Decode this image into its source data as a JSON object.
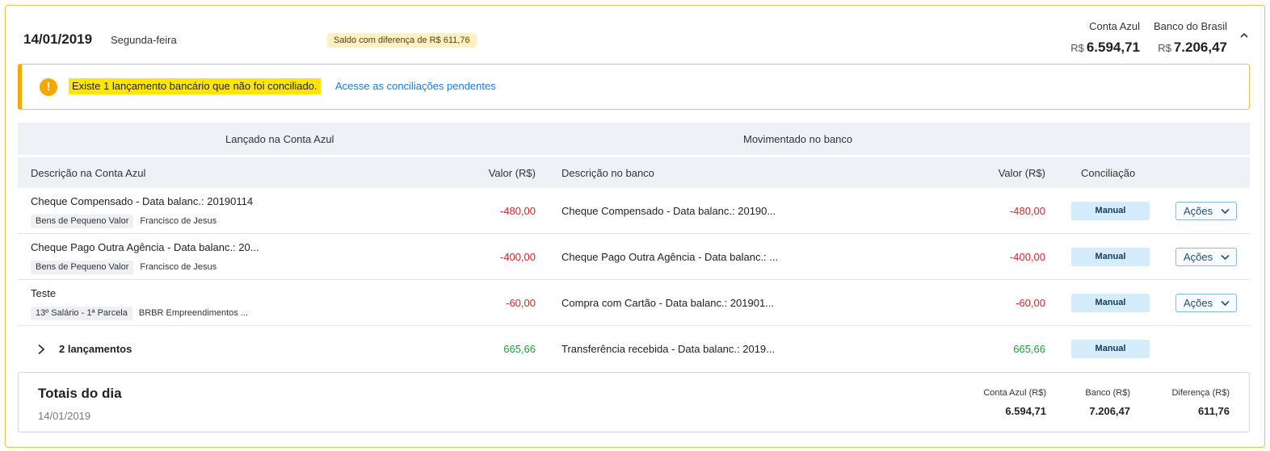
{
  "header": {
    "date": "14/01/2019",
    "weekday": "Segunda-feira",
    "badge": "Saldo com diferença de R$ 611,76",
    "accounts": [
      {
        "name": "Conta Azul",
        "currency": "R$",
        "value": "6.594,71"
      },
      {
        "name": "Banco do Brasil",
        "currency": "R$",
        "value": "7.206,47"
      }
    ],
    "collapse_icon": "chevron-up-icon"
  },
  "alert": {
    "icon": "exclamation-icon",
    "message": "Existe 1 lançamento bancário que não foi conciliado.",
    "link": "Acesse as conciliações pendentes",
    "accent_color": "#f2ac00"
  },
  "table": {
    "group_headers": [
      "Lançado na Conta Azul",
      "Movimentado no banco"
    ],
    "columns": [
      "Descrição na Conta Azul",
      "Valor (R$)",
      "Descrição no banco",
      "Valor (R$)",
      "Conciliação"
    ],
    "rows": [
      {
        "desc": "Cheque Compensado - Data balanc.: 20190114",
        "tags": [
          "Bens de Pequeno Valor",
          "Francisco de Jesus"
        ],
        "value": "-480,00",
        "bank_desc": "Cheque Compensado - Data balanc.: 20190...",
        "bank_value": "-480,00",
        "conciliation": "Manual",
        "actions": "Ações"
      },
      {
        "desc": "Cheque Pago Outra Agência - Data balanc.: 20...",
        "tags": [
          "Bens de Pequeno Valor",
          "Francisco de Jesus"
        ],
        "value": "-400,00",
        "bank_desc": "Cheque Pago Outra Agência - Data balanc.: ...",
        "bank_value": "-400,00",
        "conciliation": "Manual",
        "actions": "Ações"
      },
      {
        "desc": "Teste",
        "tags": [
          "13º Salário - 1ª Parcela",
          "BRBR Empreendimentos ..."
        ],
        "value": "-60,00",
        "bank_desc": "Compra com Cartão - Data balanc.: 201901...",
        "bank_value": "-60,00",
        "conciliation": "Manual",
        "actions": "Ações"
      }
    ],
    "group_row": {
      "label": "2 lançamentos",
      "value": "665,66",
      "bank_desc": "Transferência recebida - Data balanc.: 2019...",
      "bank_value": "665,66",
      "conciliation": "Manual"
    }
  },
  "totals": {
    "title": "Totais do dia",
    "date": "14/01/2019",
    "columns": [
      {
        "label": "Conta Azul (R$)",
        "value": "6.594,71"
      },
      {
        "label": "Banco (R$)",
        "value": "7.206,47"
      },
      {
        "label": "Diferença (R$)",
        "value": "611,76"
      }
    ]
  },
  "colors": {
    "negative": "#d9232d",
    "positive": "#1e9e3e",
    "link": "#1d7bd6",
    "highlight": "#ffe600"
  }
}
